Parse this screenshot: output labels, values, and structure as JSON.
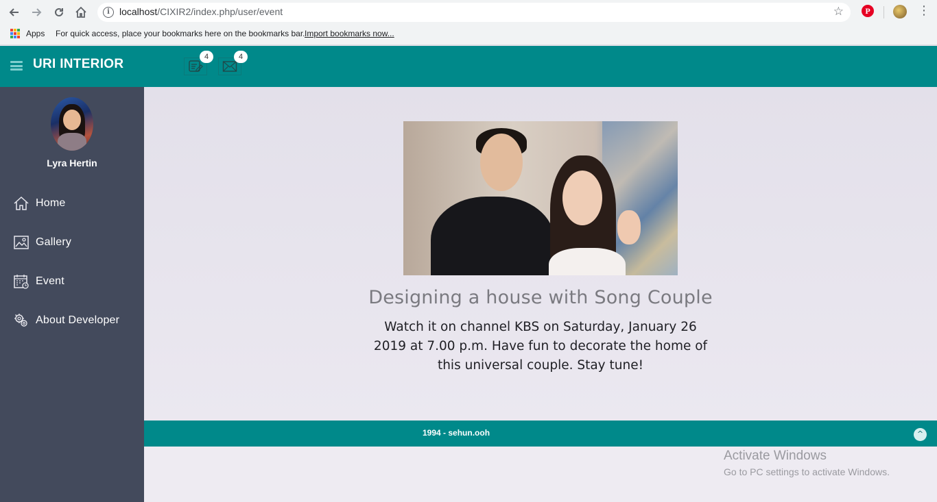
{
  "browser": {
    "url_host": "localhost",
    "url_path": "/CIXIR2/index.php/user/event",
    "bookmarks": {
      "apps_label": "Apps",
      "hint": "For quick access, place your bookmarks here on the bookmarks bar.",
      "import_link": "Import bookmarks now..."
    },
    "pinterest_label": "P"
  },
  "header": {
    "brand": "URI INTERIOR",
    "tasks_badge": "4",
    "messages_badge": "4",
    "color": "#00898a"
  },
  "sidebar": {
    "user_name": "Lyra Hertin",
    "items": [
      {
        "label": "Home",
        "icon": "home-icon"
      },
      {
        "label": "Gallery",
        "icon": "gallery-icon"
      },
      {
        "label": "Event",
        "icon": "calendar-icon"
      },
      {
        "label": "About Developer",
        "icon": "developer-icon"
      }
    ],
    "color": "#434a5c"
  },
  "event": {
    "title": "Designing a house with Song Couple",
    "description": "Watch it on channel KBS on Saturday, January 26 2019 at 7.00 p.m. Have fun to decorate the home of this universal couple. Stay tune!"
  },
  "footer": {
    "text": "1994 - sehun.ooh",
    "scroll_top_glyph": "^"
  },
  "watermark": {
    "line1": "Activate Windows",
    "line2": "Go to PC settings to activate Windows."
  }
}
